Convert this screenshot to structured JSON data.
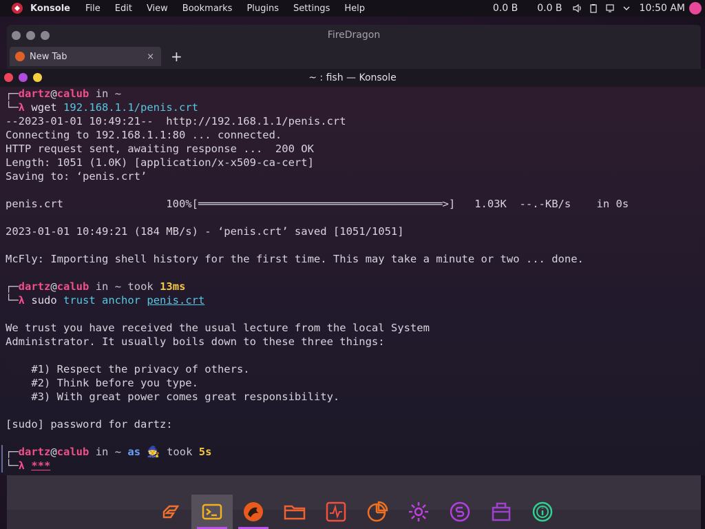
{
  "panel": {
    "app_name": "Konsole",
    "menu": [
      "File",
      "Edit",
      "View",
      "Bookmarks",
      "Plugins",
      "Settings",
      "Help"
    ],
    "net_down": "0.0 B",
    "net_up": "0.0 B",
    "clock": "10:50 AM",
    "tray_icons": [
      "volume-icon",
      "clipboard-icon",
      "network-icon",
      "chevron-down-icon"
    ]
  },
  "browser": {
    "title": "FireDragon",
    "tab_label": "New Tab",
    "tab_close": "×",
    "new_tab": "+"
  },
  "konsole": {
    "title": "~ : fish — Konsole"
  },
  "terminal": {
    "p1_user": "dartz",
    "p1_host": "calub",
    "p1_in": "in",
    "p1_dir": "~",
    "p1_cmd": "wget",
    "p1_arg": "192.168.1.1/penis.crt",
    "out1": "--2023-01-01 10:49:21--  http://192.168.1.1/penis.crt",
    "out2": "Connecting to 192.168.1.1:80 ... connected.",
    "out3": "HTTP request sent, awaiting response ...  200 OK",
    "out4": "Length: 1051 (1.0K) [application/x-x509-ca-cert]",
    "out5": "Saving to: ‘penis.crt’",
    "progress_line": "penis.crt                100%[══════════════════════════════════════>]   1.03K  --.-KB/s    in 0s",
    "out6": "2023-01-01 10:49:21 (184 MB/s) - ‘penis.crt’ saved [1051/1051]",
    "out7": "McFly: Importing shell history for the first time. This may take a minute or two ... done.",
    "p2_user": "dartz",
    "p2_host": "calub",
    "p2_in": "in",
    "p2_dir": "~",
    "p2_took": "took",
    "p2_time": "13ms",
    "p2_cmd": "sudo",
    "p2_args": "trust anchor",
    "p2_file": "penis.crt",
    "lect1": "We trust you have received the usual lecture from the local System",
    "lect2": "Administrator. It usually boils down to these three things:",
    "lect3": "    #1) Respect the privacy of others.",
    "lect4": "    #2) Think before you type.",
    "lect5": "    #3) With great power comes great responsibility.",
    "sudo_prompt": "[sudo] password for dartz:",
    "p3_user": "dartz",
    "p3_host": "calub",
    "p3_in": "in",
    "p3_dir": "~",
    "p3_as": "as",
    "p3_wizard": "🧙",
    "p3_took": "took",
    "p3_time": "5s",
    "p3_input": "***"
  },
  "dock": {
    "apps": [
      "garuda-icon",
      "konsole-icon",
      "firedragon-icon",
      "folder-icon",
      "system-monitor-icon",
      "pie-chart-icon",
      "settings-icon",
      "store-icon",
      "package-icon",
      "info-icon"
    ]
  }
}
